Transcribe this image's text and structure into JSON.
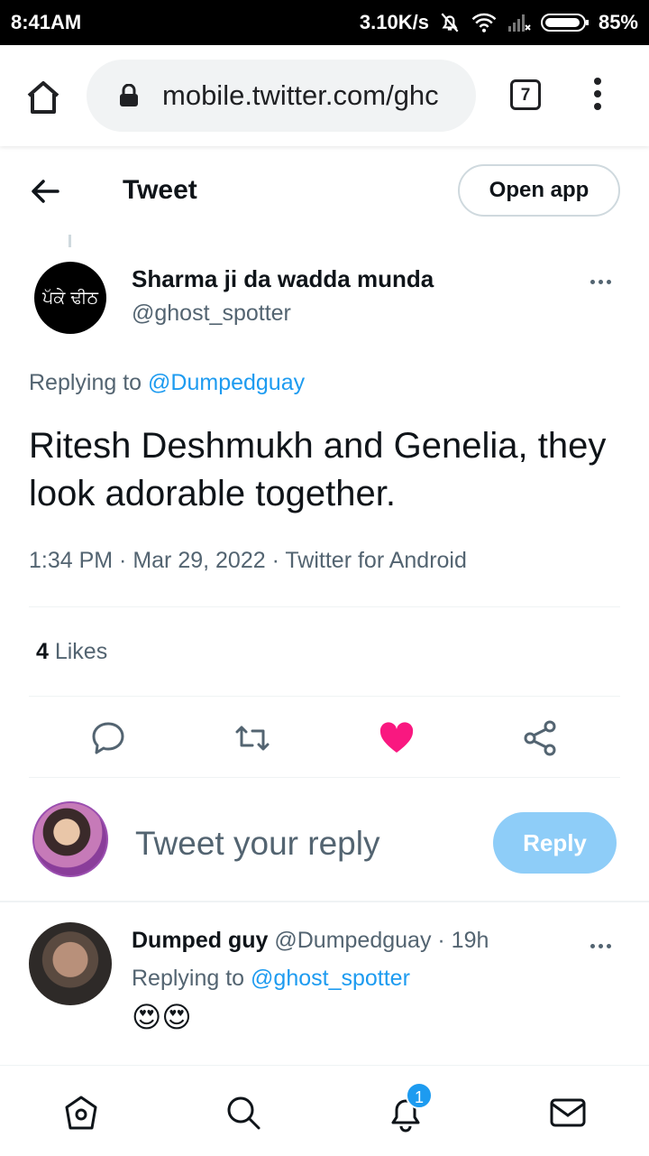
{
  "status_bar": {
    "time": "8:41AM",
    "speed": "3.10K/s",
    "battery": "85%"
  },
  "browser": {
    "url": "mobile.twitter.com/ghc",
    "tab_count": "7"
  },
  "header": {
    "title": "Tweet",
    "open_app_label": "Open app"
  },
  "tweet": {
    "avatar_text": "ਪੱਕੇ ਢੀਠ",
    "author_name": "Sharma ji da wadda munda",
    "author_handle": "@ghost_spotter",
    "replying_prefix": "Replying to ",
    "replying_to": "@Dumpedguay",
    "text": "Ritesh Deshmukh and Genelia, they look adorable together.",
    "meta": "1:34 PM · Mar 29, 2022 · Twitter for Android",
    "likes_count": "4",
    "likes_label": " Likes",
    "liked": true,
    "colors": {
      "like": "#f91880",
      "link": "#1d9bf0"
    }
  },
  "compose": {
    "placeholder": "Tweet your reply",
    "reply_label": "Reply"
  },
  "reply": {
    "author_name": "Dumped guy",
    "author_handle": "@Dumpedguay",
    "time": "19h",
    "replying_prefix": "Replying to ",
    "replying_to": "@ghost_spotter",
    "text": "😍😍"
  },
  "bottom_nav": {
    "notifications_badge": "1"
  }
}
